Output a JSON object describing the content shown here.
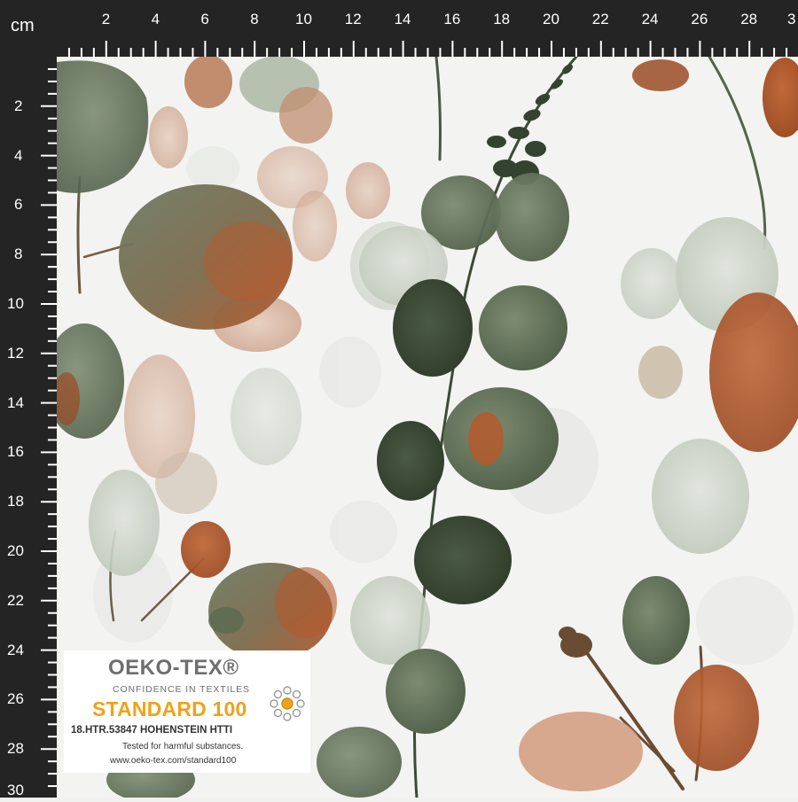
{
  "ruler": {
    "unit": "cm",
    "top_ticks": [
      "2",
      "4",
      "6",
      "8",
      "10",
      "12",
      "14",
      "16",
      "18",
      "20",
      "22",
      "24",
      "26",
      "28",
      "3"
    ],
    "left_ticks": [
      "2",
      "4",
      "6",
      "8",
      "10",
      "12",
      "14",
      "16",
      "18",
      "20",
      "22",
      "24",
      "26",
      "28",
      "30"
    ]
  },
  "badge": {
    "title": "OEKO-TEX®",
    "subtitle": "CONFIDENCE IN TEXTILES",
    "standard": "STANDARD 100",
    "id": "18.HTR.53847 HOHENSTEIN HTTI",
    "line1": "Tested for harmful substances.",
    "line2": "www.oeko-tex.com/standard100"
  },
  "colors": {
    "ruler_bg": "#242424",
    "fabric_bg": "#f3f3f1",
    "leaf_green": "#5e6e55",
    "leaf_dark": "#35432f",
    "rust": "#b05a30",
    "blush": "#d9b8a4",
    "sage_light": "#c9d0c4",
    "standard_orange": "#f1a11a"
  }
}
